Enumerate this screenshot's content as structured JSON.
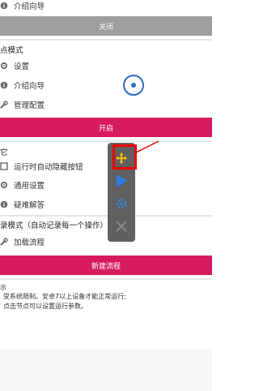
{
  "top": {
    "intro_label": "介绍向导",
    "close_button": "关闭"
  },
  "section_click": {
    "title": "点模式",
    "items": [
      {
        "label": "设置",
        "icon": "gear-icon"
      },
      {
        "label": "介绍向导",
        "icon": "info-icon"
      },
      {
        "label": "管理配置",
        "icon": "wrench-icon"
      }
    ],
    "start_button": "开启"
  },
  "section_other": {
    "title": "它",
    "checkbox_label": "运行时自动隐藏按钮",
    "items": [
      {
        "label": "通用设置",
        "icon": "gear-icon"
      },
      {
        "label": "疑难解答",
        "icon": "info-icon"
      }
    ]
  },
  "section_record": {
    "title": "录模式（自动记录每一个操作）",
    "items": [
      {
        "label": "加载流程",
        "icon": "wrench-icon"
      }
    ],
    "new_flow_button": "新建流程"
  },
  "tips": {
    "title": "示",
    "line1": "受系统限制。安卓7以上设备才能正常运行;",
    "line2": "点击节点可以设置运行参数。"
  },
  "float_panel": {
    "move_icon": "move-icon",
    "play_icon": "play-icon",
    "settings_icon": "gear-icon",
    "close_icon": "close-icon"
  },
  "colors": {
    "accent_pink": "#d81b60",
    "gray_button": "#9e9e9e",
    "panel": "#606060",
    "highlight": "#f00000",
    "play_blue": "#2f7de1",
    "move_yellow": "#f2c100"
  }
}
